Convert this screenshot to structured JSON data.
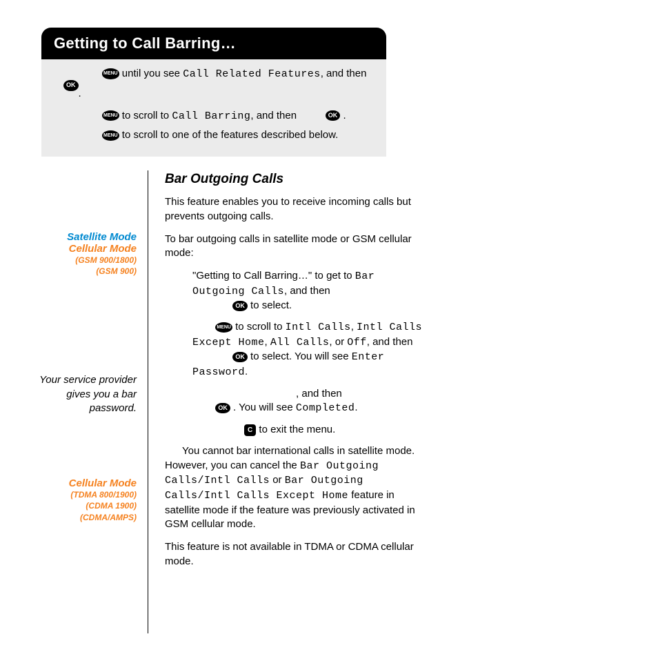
{
  "header": {
    "title": "Getting to Call Barring…"
  },
  "topbox": {
    "l1a": " until you see ",
    "l1b": "Call Related Features",
    "l1c": ", and then",
    "l1d": " .",
    "l2a": " to scroll to ",
    "l2b": "Call Barring",
    "l2c": ", and then ",
    "l2d": " .",
    "l3": " to scroll to one of the features described below."
  },
  "icons": {
    "ok": "OK",
    "menu": "MENU",
    "c": "C"
  },
  "side": {
    "satMode": "Satellite Mode",
    "cellMode": "Cellular Mode",
    "gsm1": "(GSM 900/1800)",
    "gsm2": "(GSM 900)",
    "tip": "Your service provider gives you a bar password.",
    "cellMode2": "Cellular Mode",
    "tdma": "(TDMA 800/1900)",
    "cdma1": "(CDMA 1900)",
    "cdma2": "(CDMA/AMPS)"
  },
  "main": {
    "sectionTitle": "Bar Outgoing Calls",
    "p1": "This feature enables you to receive incoming calls but prevents outgoing calls.",
    "p2": "To bar outgoing calls in satellite mode or GSM cellular mode:",
    "s1a": "\"Getting to Call Barring…\" to get to ",
    "s1b": "Bar Outgoing Calls",
    "s1c": ", and then ",
    "s1d": " to select.",
    "s2a": " to scroll to ",
    "s2b": "Intl Calls",
    "s2c": ", ",
    "s2d": "Intl Calls Except Home",
    "s2e": ", ",
    "s2f": "All Calls",
    "s2g": ", or ",
    "s2h": "Off",
    "s2i": ", and then ",
    "s2j": " to select. You will see ",
    "s2k": "Enter Password",
    "s2l": ".",
    "s3a": ", and then ",
    "s3b": " . You will see ",
    "s3c": "Completed",
    "s3d": ".",
    "s4a": " to exit the menu.",
    "note1a": "You cannot bar international calls in satellite mode. However, you can cancel the ",
    "note1b": "Bar Outgoing Calls/Intl Calls",
    "note1c": " or ",
    "note1d": "Bar Outgoing Calls/Intl Calls Except Home",
    "note1e": " feature in satellite mode if the feature was previously activated in GSM cellular mode.",
    "p3": "This feature is not available in TDMA or CDMA cellular mode."
  }
}
